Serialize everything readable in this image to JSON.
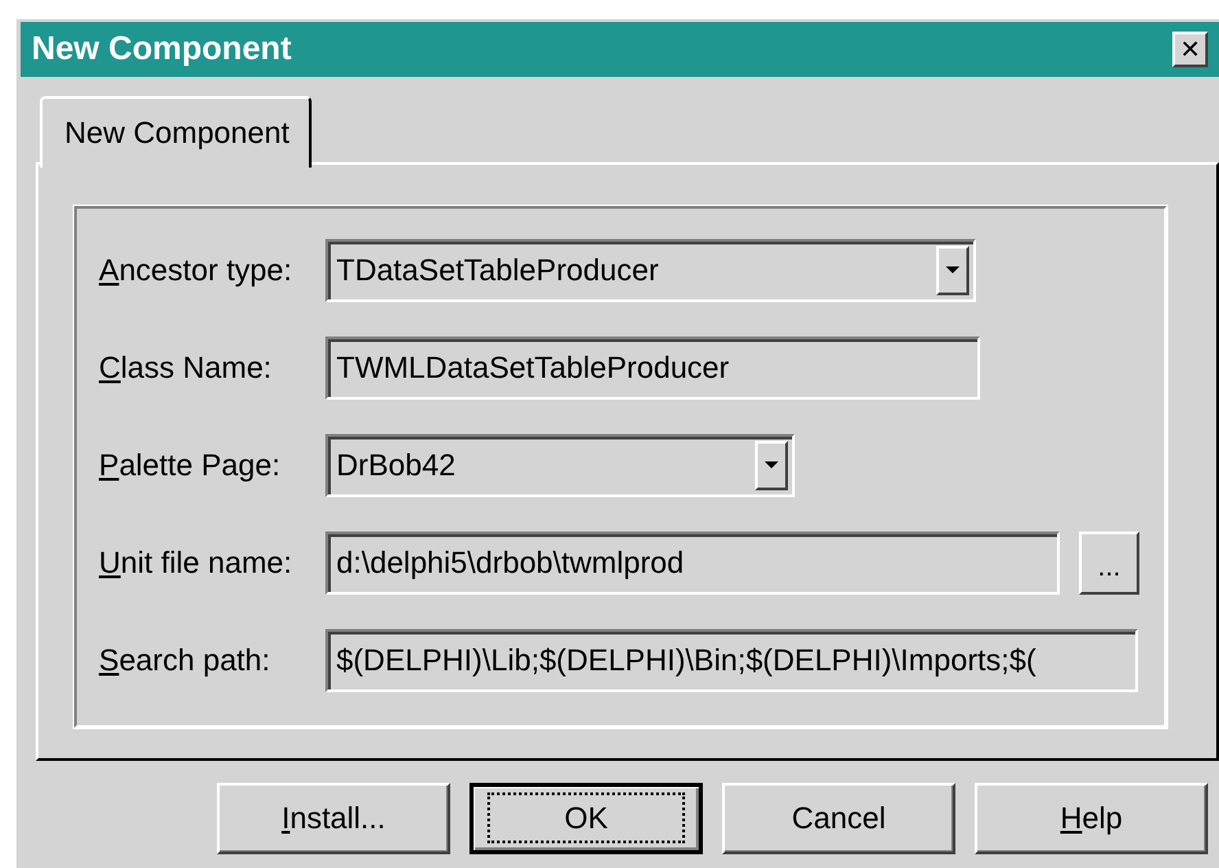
{
  "window": {
    "title": "New Component",
    "close_glyph": "✕"
  },
  "tabs": [
    {
      "label": "New Component",
      "selected": true
    }
  ],
  "fields": [
    {
      "kind": "combo",
      "label_key": "A",
      "label_rest": "ncestor type:",
      "value": "TDataSetTableProducer"
    },
    {
      "kind": "text",
      "label_key": "C",
      "label_rest": "lass Name:",
      "value": "TWMLDataSetTableProducer"
    },
    {
      "kind": "combo",
      "label_key": "P",
      "label_rest": "alette Page:",
      "value": "DrBob42"
    },
    {
      "kind": "browse",
      "label_key": "U",
      "label_rest": "nit file name:",
      "value": "d:\\delphi5\\drbob\\twmlprod",
      "browse_label": "..."
    },
    {
      "kind": "text",
      "label_key": "S",
      "label_rest": "earch path:",
      "value": "$(DELPHI)\\Lib;$(DELPHI)\\Bin;$(DELPHI)\\Imports;$("
    }
  ],
  "buttons": [
    {
      "label_key": "I",
      "label_rest": "nstall...",
      "default": false
    },
    {
      "label_rest": "OK",
      "default": true
    },
    {
      "label_rest": "Cancel",
      "default": false
    },
    {
      "label_key": "H",
      "label_rest": "elp",
      "default": false
    }
  ]
}
